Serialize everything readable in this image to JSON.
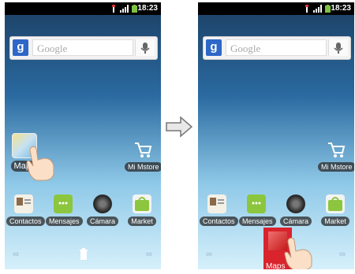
{
  "status": {
    "time": "18:23"
  },
  "search": {
    "g_label": "g",
    "placeholder": "Google"
  },
  "left": {
    "shortcut_label": "Maps",
    "mstore_label": "Mi Mstore",
    "dock": [
      "Contactos",
      "Mensajes",
      "Cámara",
      "Market"
    ]
  },
  "right": {
    "mstore_label": "Mi Mstore",
    "dock": [
      "Contactos",
      "Mensajes",
      "Cámara",
      "Market"
    ],
    "dragging_label": "Maps"
  },
  "icons": {
    "maps": "maps-icon",
    "store": "mstore-icon",
    "contacts": "contacts-icon",
    "messages": "messages-icon",
    "camera": "camera-icon",
    "market": "market-icon",
    "trash": "trash-icon",
    "hand": "hand-pointer-icon",
    "arrow": "arrow-right-icon"
  },
  "colors": {
    "accent": "#2d67c8",
    "delete_highlight": "#d9232d"
  }
}
